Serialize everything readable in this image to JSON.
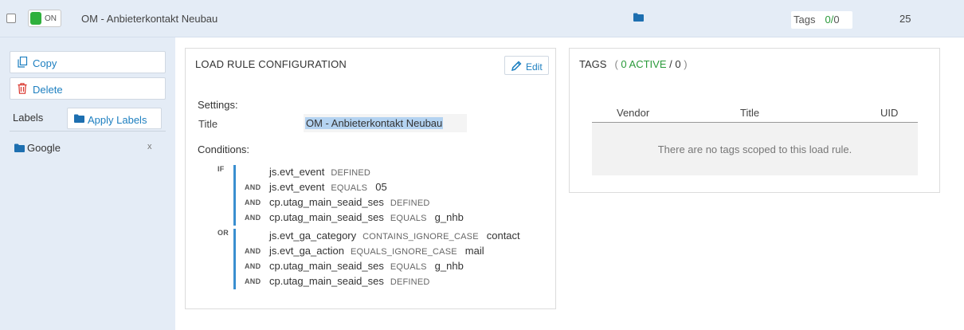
{
  "header": {
    "toggle_label": "ON",
    "rule_name": "OM - Anbieterkontakt Neubau",
    "tags_label": "Tags",
    "tags_active": "0",
    "tags_separator": "/",
    "tags_total": "0",
    "count": "25"
  },
  "sidebar": {
    "copy_label": "Copy",
    "delete_label": "Delete",
    "labels_heading": "Labels",
    "apply_labels_label": "Apply Labels",
    "label_items": [
      {
        "name": "Google",
        "remove": "x"
      }
    ]
  },
  "config": {
    "title": "LOAD RULE CONFIGURATION",
    "edit_label": "Edit",
    "settings_heading": "Settings:",
    "title_field_label": "Title",
    "title_field_value": "OM - Anbieterkontakt Neubau",
    "conditions_heading": "Conditions:",
    "groups": [
      {
        "op": "IF",
        "conditions": [
          {
            "join": "",
            "variable": "js.evt_event",
            "operator": "DEFINED",
            "value": ""
          },
          {
            "join": "AND",
            "variable": "js.evt_event",
            "operator": "EQUALS",
            "value": "05"
          },
          {
            "join": "AND",
            "variable": "cp.utag_main_seaid_ses",
            "operator": "DEFINED",
            "value": ""
          },
          {
            "join": "AND",
            "variable": "cp.utag_main_seaid_ses",
            "operator": "EQUALS",
            "value": "g_nhb"
          }
        ]
      },
      {
        "op": "OR",
        "conditions": [
          {
            "join": "",
            "variable": "js.evt_ga_category",
            "operator": "CONTAINS_IGNORE_CASE",
            "value": "contact"
          },
          {
            "join": "AND",
            "variable": "js.evt_ga_action",
            "operator": "EQUALS_IGNORE_CASE",
            "value": "mail"
          },
          {
            "join": "AND",
            "variable": "cp.utag_main_seaid_ses",
            "operator": "EQUALS",
            "value": "g_nhb"
          },
          {
            "join": "AND",
            "variable": "cp.utag_main_seaid_ses",
            "operator": "DEFINED",
            "value": ""
          }
        ]
      }
    ]
  },
  "tags_panel": {
    "title": "TAGS",
    "paren_open": "(",
    "active_text": "0 ACTIVE",
    "slash": "/",
    "total": "0",
    "paren_close": ")",
    "columns": [
      "Vendor",
      "Title",
      "UID"
    ],
    "empty_message": "There are no tags scoped to this load rule."
  },
  "colors": {
    "accent": "#1d7fc0",
    "active_green": "#2a9a3a",
    "header_bg": "#e4ecf6",
    "condition_bar": "#3a8fd0"
  }
}
